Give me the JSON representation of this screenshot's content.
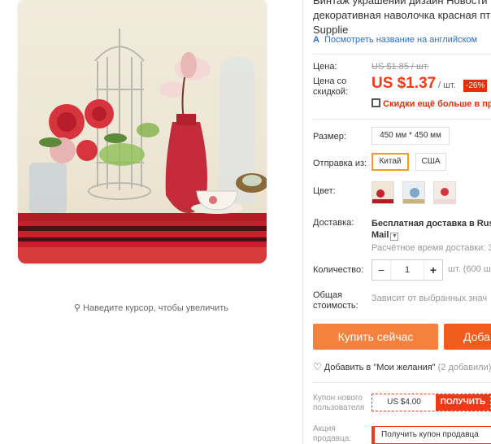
{
  "product": {
    "title_lines": [
      "Винтаж украшений дизайн Новости",
      "декоративная наволочка красная пт",
      "Supplie"
    ],
    "translate_link": "Посмотреть название на английском",
    "image_hint": "Наведите курсор, чтобы увеличить"
  },
  "price": {
    "label": "Цена:",
    "old": "US $1.85 / шт.",
    "discount_label_1": "Цена со",
    "discount_label_2": "скидкой:",
    "new": "US $1.37",
    "per_unit": "/ шт.",
    "badge": "-26%",
    "promo": "Скидки ещё больше в прил"
  },
  "options": {
    "size_label": "Размер:",
    "size_value": "450 мм * 450 мм",
    "ship_from_label": "Отправка из:",
    "ship_from_options": [
      "Китай",
      "США"
    ],
    "ship_from_selected": "Китай",
    "color_label": "Цвет:"
  },
  "delivery": {
    "label": "Доставка:",
    "line1": "Бесплатная доставка в Russi",
    "line2": "Mail",
    "estimate": "Расчётное время доставки: 30"
  },
  "quantity": {
    "label": "Количество:",
    "value": "1",
    "minus": "−",
    "plus": "+",
    "note": "шт. (600 шт"
  },
  "total": {
    "label_1": "Общая",
    "label_2": "стоимость:",
    "note": "Зависит от выбранных знач"
  },
  "actions": {
    "buy_now": "Купить сейчас",
    "add_to_cart": "Доба",
    "wishlist": "Добавить в \"Мои желания\"",
    "wishlist_count": "(2 добавили)"
  },
  "coupons": {
    "new_user_label_1": "Купон нового",
    "new_user_label_2": "пользователя",
    "amount": "US $4.00",
    "get": "ПОЛУЧИТЬ",
    "promo_label_1": "Акция",
    "promo_label_2": "продавца:",
    "seller_coupon": "Получить купон продавца"
  },
  "colors": {
    "accent_orange": "#f6813f",
    "price_red": "#f03a17",
    "link_blue": "#2a6fc9",
    "selected_border": "#f39c12"
  }
}
